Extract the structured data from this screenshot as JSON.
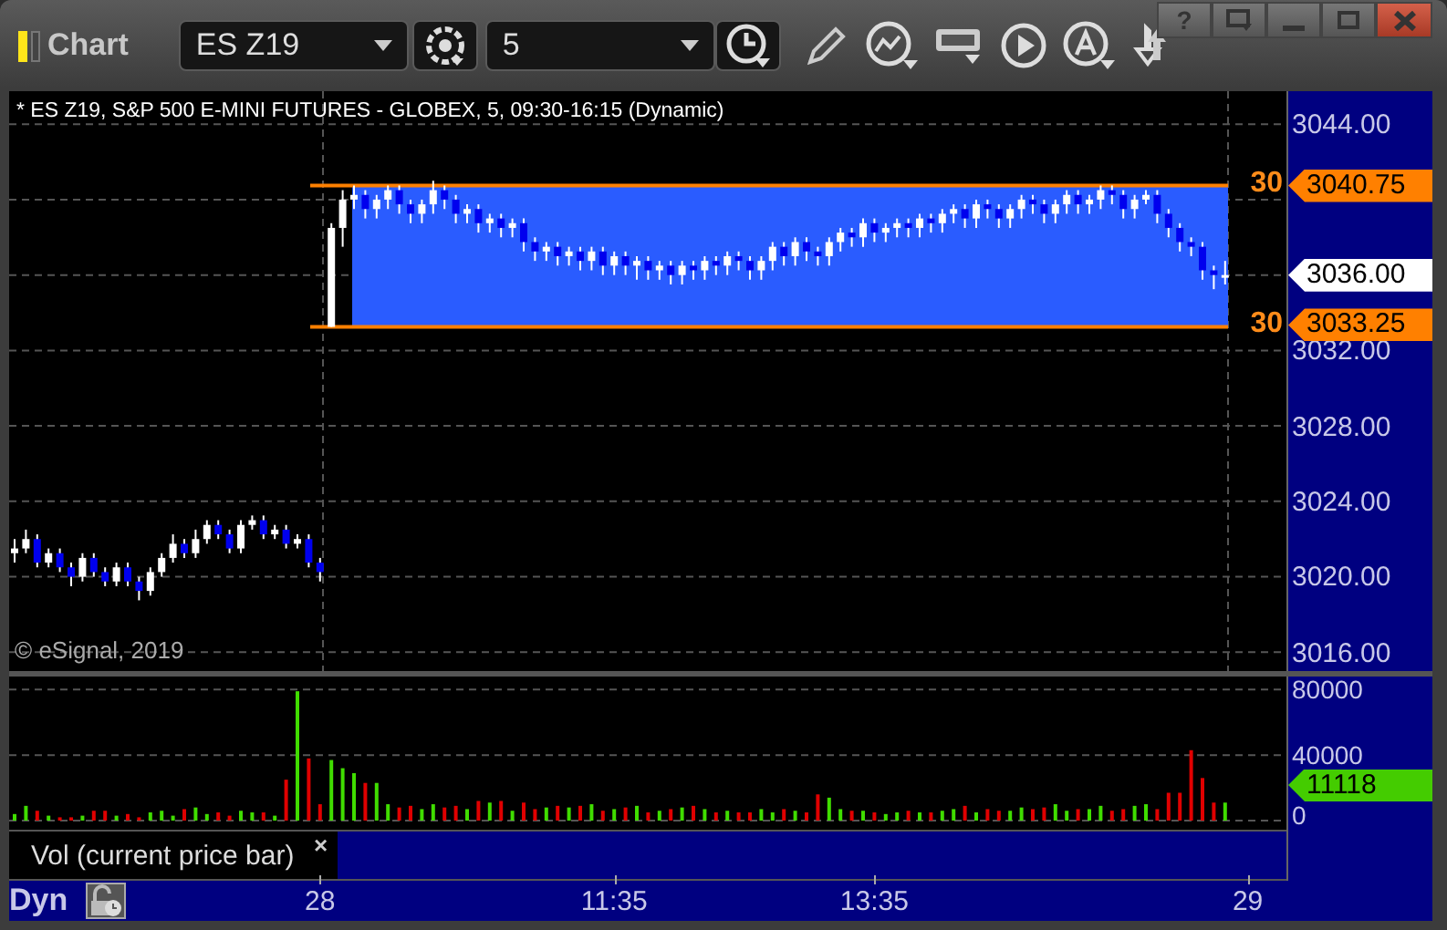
{
  "window": {
    "title": "Chart",
    "help": "?"
  },
  "toolbar": {
    "symbol": "ES Z19",
    "interval": "5"
  },
  "chart": {
    "title": "* ES Z19, S&P 500 E-MINI FUTURES - GLOBEX, 5, 09:30-16:15 (Dynamic)",
    "copyright": "© eSignal, 2019",
    "price_tags": [
      {
        "text": "3040.75",
        "color": "#ff8000"
      },
      {
        "text": "3036.00",
        "color": "#ffffff"
      },
      {
        "text": "3033.25",
        "color": "#ff8000"
      }
    ],
    "line_labels": [
      "30",
      "30"
    ],
    "chart_data": {
      "type": "candlestick",
      "grid": true,
      "ylim": [
        3015,
        3045.75
      ],
      "yticks": [
        {
          "value": 3044,
          "label": "3044.00"
        },
        {
          "value": 3032,
          "label": "3032.00"
        },
        {
          "value": 3028,
          "label": "3028.00"
        },
        {
          "value": 3024,
          "label": "3024.00"
        },
        {
          "value": 3020,
          "label": "3020.00"
        },
        {
          "value": 3016,
          "label": "3016.00"
        }
      ],
      "ohlc": [
        [
          3021.25,
          3022,
          3020.75,
          3021.5
        ],
        [
          3021.5,
          3022.5,
          3021.25,
          3022
        ],
        [
          3022,
          3022.25,
          3020.5,
          3020.75
        ],
        [
          3020.75,
          3021.5,
          3020.5,
          3021.25
        ],
        [
          3021.25,
          3021.5,
          3020.25,
          3020.5
        ],
        [
          3020.5,
          3020.75,
          3019.5,
          3020
        ],
        [
          3020,
          3021.25,
          3019.75,
          3021
        ],
        [
          3021,
          3021.25,
          3020,
          3020.25
        ],
        [
          3020.25,
          3020.5,
          3019.5,
          3019.75
        ],
        [
          3019.75,
          3020.75,
          3019.5,
          3020.5
        ],
        [
          3020.5,
          3020.75,
          3019.5,
          3019.75
        ],
        [
          3019.75,
          3020,
          3018.75,
          3019.25
        ],
        [
          3019.25,
          3020.5,
          3019,
          3020.25
        ],
        [
          3020.25,
          3021.25,
          3020,
          3021
        ],
        [
          3021,
          3022.25,
          3020.75,
          3021.75
        ],
        [
          3021.75,
          3022,
          3021,
          3021.25
        ],
        [
          3021.25,
          3022.5,
          3021,
          3022
        ],
        [
          3022,
          3023,
          3021.75,
          3022.75
        ],
        [
          3022.75,
          3023,
          3022,
          3022.25
        ],
        [
          3022.25,
          3022.5,
          3021.25,
          3021.5
        ],
        [
          3021.5,
          3023,
          3021.25,
          3022.75
        ],
        [
          3022.75,
          3023.25,
          3022.5,
          3023
        ],
        [
          3023,
          3023.25,
          3022,
          3022.25
        ],
        [
          3022.25,
          3022.75,
          3022,
          3022.5
        ],
        [
          3022.5,
          3022.75,
          3021.5,
          3021.75
        ],
        [
          3021.75,
          3022.25,
          3021.5,
          3022
        ],
        [
          3022,
          3022.25,
          3020.5,
          3020.75
        ],
        [
          3020.75,
          3021,
          3019.75,
          3020.25
        ],
        [
          3033.25,
          3038.75,
          3033.25,
          3038.5
        ],
        [
          3038.5,
          3040.5,
          3037.5,
          3040
        ],
        [
          3040,
          3040.75,
          3039.5,
          3040.25
        ],
        [
          3040.25,
          3040.5,
          3039,
          3039.5
        ],
        [
          3039.5,
          3040.25,
          3039,
          3040
        ],
        [
          3040,
          3040.75,
          3039.5,
          3040.5
        ],
        [
          3040.5,
          3040.75,
          3039.25,
          3039.75
        ],
        [
          3039.75,
          3040,
          3038.75,
          3039.25
        ],
        [
          3039.25,
          3040,
          3038.75,
          3039.75
        ],
        [
          3039.75,
          3041,
          3039.25,
          3040.5
        ],
        [
          3040.5,
          3040.75,
          3039.5,
          3040
        ],
        [
          3040,
          3040.25,
          3038.75,
          3039.25
        ],
        [
          3039.25,
          3039.75,
          3038.75,
          3039.5
        ],
        [
          3039.5,
          3039.75,
          3038.25,
          3038.75
        ],
        [
          3038.75,
          3039.25,
          3038.25,
          3039
        ],
        [
          3039,
          3039.25,
          3038,
          3038.5
        ],
        [
          3038.5,
          3039,
          3038,
          3038.75
        ],
        [
          3038.75,
          3039,
          3037.25,
          3037.75
        ],
        [
          3037.75,
          3038,
          3036.75,
          3037.25
        ],
        [
          3037.25,
          3037.75,
          3036.75,
          3037.5
        ],
        [
          3037.5,
          3037.75,
          3036.5,
          3037
        ],
        [
          3037,
          3037.5,
          3036.5,
          3037.25
        ],
        [
          3037.25,
          3037.5,
          3036.25,
          3036.75
        ],
        [
          3036.75,
          3037.5,
          3036.25,
          3037.25
        ],
        [
          3037.25,
          3037.5,
          3036,
          3036.5
        ],
        [
          3036.5,
          3037.25,
          3036,
          3037
        ],
        [
          3037,
          3037.25,
          3036,
          3036.5
        ],
        [
          3036.5,
          3037,
          3035.75,
          3036.75
        ],
        [
          3036.75,
          3037,
          3035.75,
          3036.25
        ],
        [
          3036.25,
          3036.75,
          3035.75,
          3036.5
        ],
        [
          3036.5,
          3036.75,
          3035.5,
          3036
        ],
        [
          3036,
          3036.75,
          3035.5,
          3036.5
        ],
        [
          3036.5,
          3036.75,
          3035.75,
          3036.25
        ],
        [
          3036.25,
          3037,
          3035.75,
          3036.75
        ],
        [
          3036.75,
          3037,
          3036,
          3036.5
        ],
        [
          3036.5,
          3037.25,
          3036,
          3037
        ],
        [
          3037,
          3037.25,
          3036.25,
          3036.75
        ],
        [
          3036.75,
          3037,
          3035.75,
          3036.25
        ],
        [
          3036.25,
          3037,
          3035.75,
          3036.75
        ],
        [
          3036.75,
          3037.75,
          3036.25,
          3037.5
        ],
        [
          3037.5,
          3037.75,
          3036.5,
          3037
        ],
        [
          3037,
          3038,
          3036.5,
          3037.75
        ],
        [
          3037.75,
          3038,
          3036.75,
          3037.25
        ],
        [
          3037.25,
          3037.5,
          3036.5,
          3037
        ],
        [
          3037,
          3038,
          3036.5,
          3037.75
        ],
        [
          3037.75,
          3038.5,
          3037.25,
          3038.25
        ],
        [
          3038.25,
          3038.5,
          3037.5,
          3038
        ],
        [
          3038,
          3039,
          3037.5,
          3038.75
        ],
        [
          3038.75,
          3039,
          3037.75,
          3038.25
        ],
        [
          3038.25,
          3038.75,
          3037.75,
          3038.5
        ],
        [
          3038.5,
          3039,
          3038,
          3038.75
        ],
        [
          3038.75,
          3039,
          3038,
          3038.5
        ],
        [
          3038.5,
          3039.25,
          3038,
          3039
        ],
        [
          3039,
          3039.25,
          3038.25,
          3038.75
        ],
        [
          3038.75,
          3039.5,
          3038.25,
          3039.25
        ],
        [
          3039.25,
          3039.75,
          3038.75,
          3039.5
        ],
        [
          3039.5,
          3039.75,
          3038.5,
          3039
        ],
        [
          3039,
          3040,
          3038.5,
          3039.75
        ],
        [
          3039.75,
          3040,
          3039,
          3039.5
        ],
        [
          3039.5,
          3039.75,
          3038.5,
          3039
        ],
        [
          3039,
          3039.75,
          3038.5,
          3039.5
        ],
        [
          3039.5,
          3040.25,
          3039,
          3040
        ],
        [
          3040,
          3040.25,
          3039.25,
          3039.75
        ],
        [
          3039.75,
          3040,
          3038.75,
          3039.25
        ],
        [
          3039.25,
          3040,
          3038.75,
          3039.75
        ],
        [
          3039.75,
          3040.5,
          3039.25,
          3040.25
        ],
        [
          3040.25,
          3040.5,
          3039.25,
          3039.75
        ],
        [
          3039.75,
          3040.25,
          3039.25,
          3040
        ],
        [
          3040,
          3040.75,
          3039.5,
          3040.5
        ],
        [
          3040.5,
          3040.75,
          3039.75,
          3040.25
        ],
        [
          3040.25,
          3040.5,
          3039,
          3039.5
        ],
        [
          3039.5,
          3040.25,
          3039,
          3040
        ],
        [
          3040,
          3040.5,
          3039.75,
          3040.25
        ],
        [
          3040.25,
          3040.5,
          3038.75,
          3039.25
        ],
        [
          3039.25,
          3039.5,
          3038,
          3038.5
        ],
        [
          3038.5,
          3038.75,
          3037.25,
          3037.75
        ],
        [
          3037.75,
          3038,
          3037,
          3037.5
        ],
        [
          3037.5,
          3037.75,
          3035.75,
          3036.25
        ],
        [
          3036.25,
          3036.5,
          3035.25,
          3036
        ],
        [
          3036,
          3036.75,
          3035.5,
          3036
        ]
      ]
    },
    "volume": {
      "chart_data": {
        "type": "bar",
        "grid": true,
        "ylim": [
          0,
          88000
        ],
        "categories": [
          null,
          null,
          null,
          null,
          null,
          null,
          null,
          null,
          null,
          null,
          null,
          null,
          null,
          null,
          null,
          null,
          null,
          null,
          null,
          null,
          null,
          null,
          null,
          null,
          null,
          null,
          null,
          "28",
          null,
          null,
          null,
          null,
          null,
          null,
          null,
          null,
          null,
          null,
          null,
          null,
          null,
          null,
          null,
          null,
          null,
          null,
          null,
          null,
          null,
          null,
          null,
          null,
          null,
          "11:35",
          null,
          null,
          null,
          null,
          null,
          null,
          null,
          null,
          null,
          null,
          null,
          null,
          null,
          null,
          null,
          null,
          null,
          null,
          null,
          null,
          null,
          null,
          "13:35",
          null,
          null,
          null,
          null,
          null,
          null,
          null,
          null,
          null,
          null,
          null,
          null,
          null,
          null,
          null,
          null,
          null,
          null,
          null,
          null,
          null,
          null,
          null,
          null,
          null,
          null,
          null,
          null,
          null,
          null,
          null,
          null,
          "29"
        ],
        "yticks": [
          {
            "value": 80000,
            "label": "80000"
          },
          {
            "value": 40000,
            "label": "40000"
          },
          {
            "value": 0,
            "label": "0"
          }
        ],
        "values": [
          4000,
          9000,
          6000,
          3000,
          2000,
          2000,
          3000,
          6000,
          6000,
          3000,
          4000,
          2000,
          5000,
          6000,
          3000,
          7000,
          8000,
          4000,
          5000,
          3000,
          6000,
          5000,
          5000,
          3000,
          25000,
          79000,
          38000,
          10000,
          37000,
          32000,
          29000,
          23000,
          23000,
          10000,
          8000,
          9000,
          7000,
          10000,
          8000,
          9000,
          7000,
          12000,
          11000,
          12000,
          6000,
          11000,
          7000,
          8000,
          9000,
          8000,
          9000,
          10000,
          6000,
          7000,
          8000,
          9000,
          5000,
          6000,
          7000,
          8000,
          9000,
          7000,
          5000,
          6000,
          5000,
          5000,
          7000,
          5000,
          7000,
          6000,
          5000,
          16000,
          14000,
          7000,
          6000,
          6000,
          5000,
          4000,
          5000,
          6000,
          5000,
          5000,
          6000,
          7000,
          9000,
          5000,
          7000,
          6000,
          6000,
          8000,
          7000,
          8000,
          10000,
          6000,
          7000,
          7000,
          9000,
          6000,
          7000,
          9000,
          10000,
          7000,
          17000,
          17000,
          43000,
          26000,
          11000,
          11000,
          null,
          null
        ]
      },
      "tag": {
        "text": "11118",
        "color": "#44cc00"
      }
    },
    "study": {
      "name": "Vol (current price bar)",
      "close": "×"
    },
    "mode": "Dyn"
  }
}
